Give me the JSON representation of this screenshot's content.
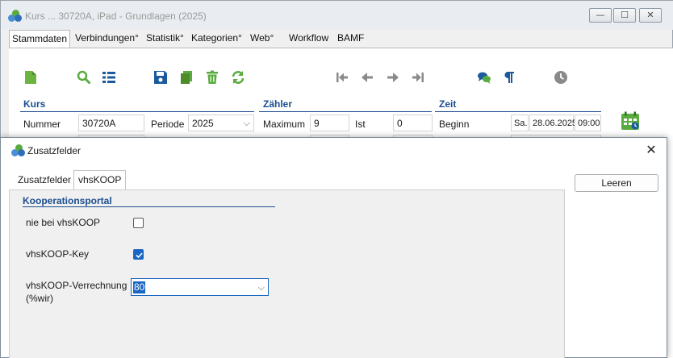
{
  "main_window": {
    "title": "Kurs ... 30720A, iPad - Grundlagen (2025)",
    "window_buttons": [
      "—",
      "☐",
      "✕"
    ],
    "tabs": [
      {
        "label": "Stammdaten",
        "active": true
      },
      {
        "label": "Verbindungen°"
      },
      {
        "label": "Statistik°"
      },
      {
        "label": "Kategorien°"
      },
      {
        "label": "Web°"
      },
      {
        "label": "Workflow"
      },
      {
        "label": "BAMF"
      }
    ],
    "toolbar": [
      "new-document-icon",
      "search-icon",
      "list-icon",
      "save-icon",
      "copy-icon",
      "delete-icon",
      "refresh-icon",
      "first-record-icon",
      "previous-record-icon",
      "next-record-icon",
      "last-record-icon",
      "comments-icon",
      "paragraph-icon",
      "history-clock-icon"
    ],
    "groups": {
      "kurs": {
        "title": "Kurs",
        "nummer_label": "Nummer",
        "nummer_value": "30720A",
        "periode_label": "Periode",
        "periode_value": "2025"
      },
      "zaehler": {
        "title": "Zähler",
        "maximum_label": "Maximum",
        "maximum_value": "9",
        "ist_label": "Ist",
        "ist_value": "0"
      },
      "zeit": {
        "title": "Zeit",
        "beginn_label": "Beginn",
        "beginn_day": "Sa.",
        "beginn_date": "28.06.2025",
        "beginn_time": "09:00"
      }
    },
    "colors": {
      "accent_green": "#5aab3f",
      "accent_blue": "#1b4d8f",
      "nav_gray": "#8a8a8a"
    }
  },
  "dialog": {
    "title": "Zusatzfelder",
    "close_glyph": "✕",
    "tabs": [
      {
        "label": "Zusatzfelder"
      },
      {
        "label": "vhsKOOP",
        "active": true
      }
    ],
    "reset_button": "Leeren",
    "section_title": "Kooperationsportal",
    "fields": {
      "nie_bei_vhskoop": {
        "label": "nie bei vhsKOOP",
        "checked": false
      },
      "vhskoop_key": {
        "label": "vhsKOOP-Key",
        "checked": true
      },
      "verrechnung": {
        "label_line1": "vhsKOOP-Verrechnung",
        "label_line2": "(%wir)",
        "value": "80"
      }
    }
  }
}
